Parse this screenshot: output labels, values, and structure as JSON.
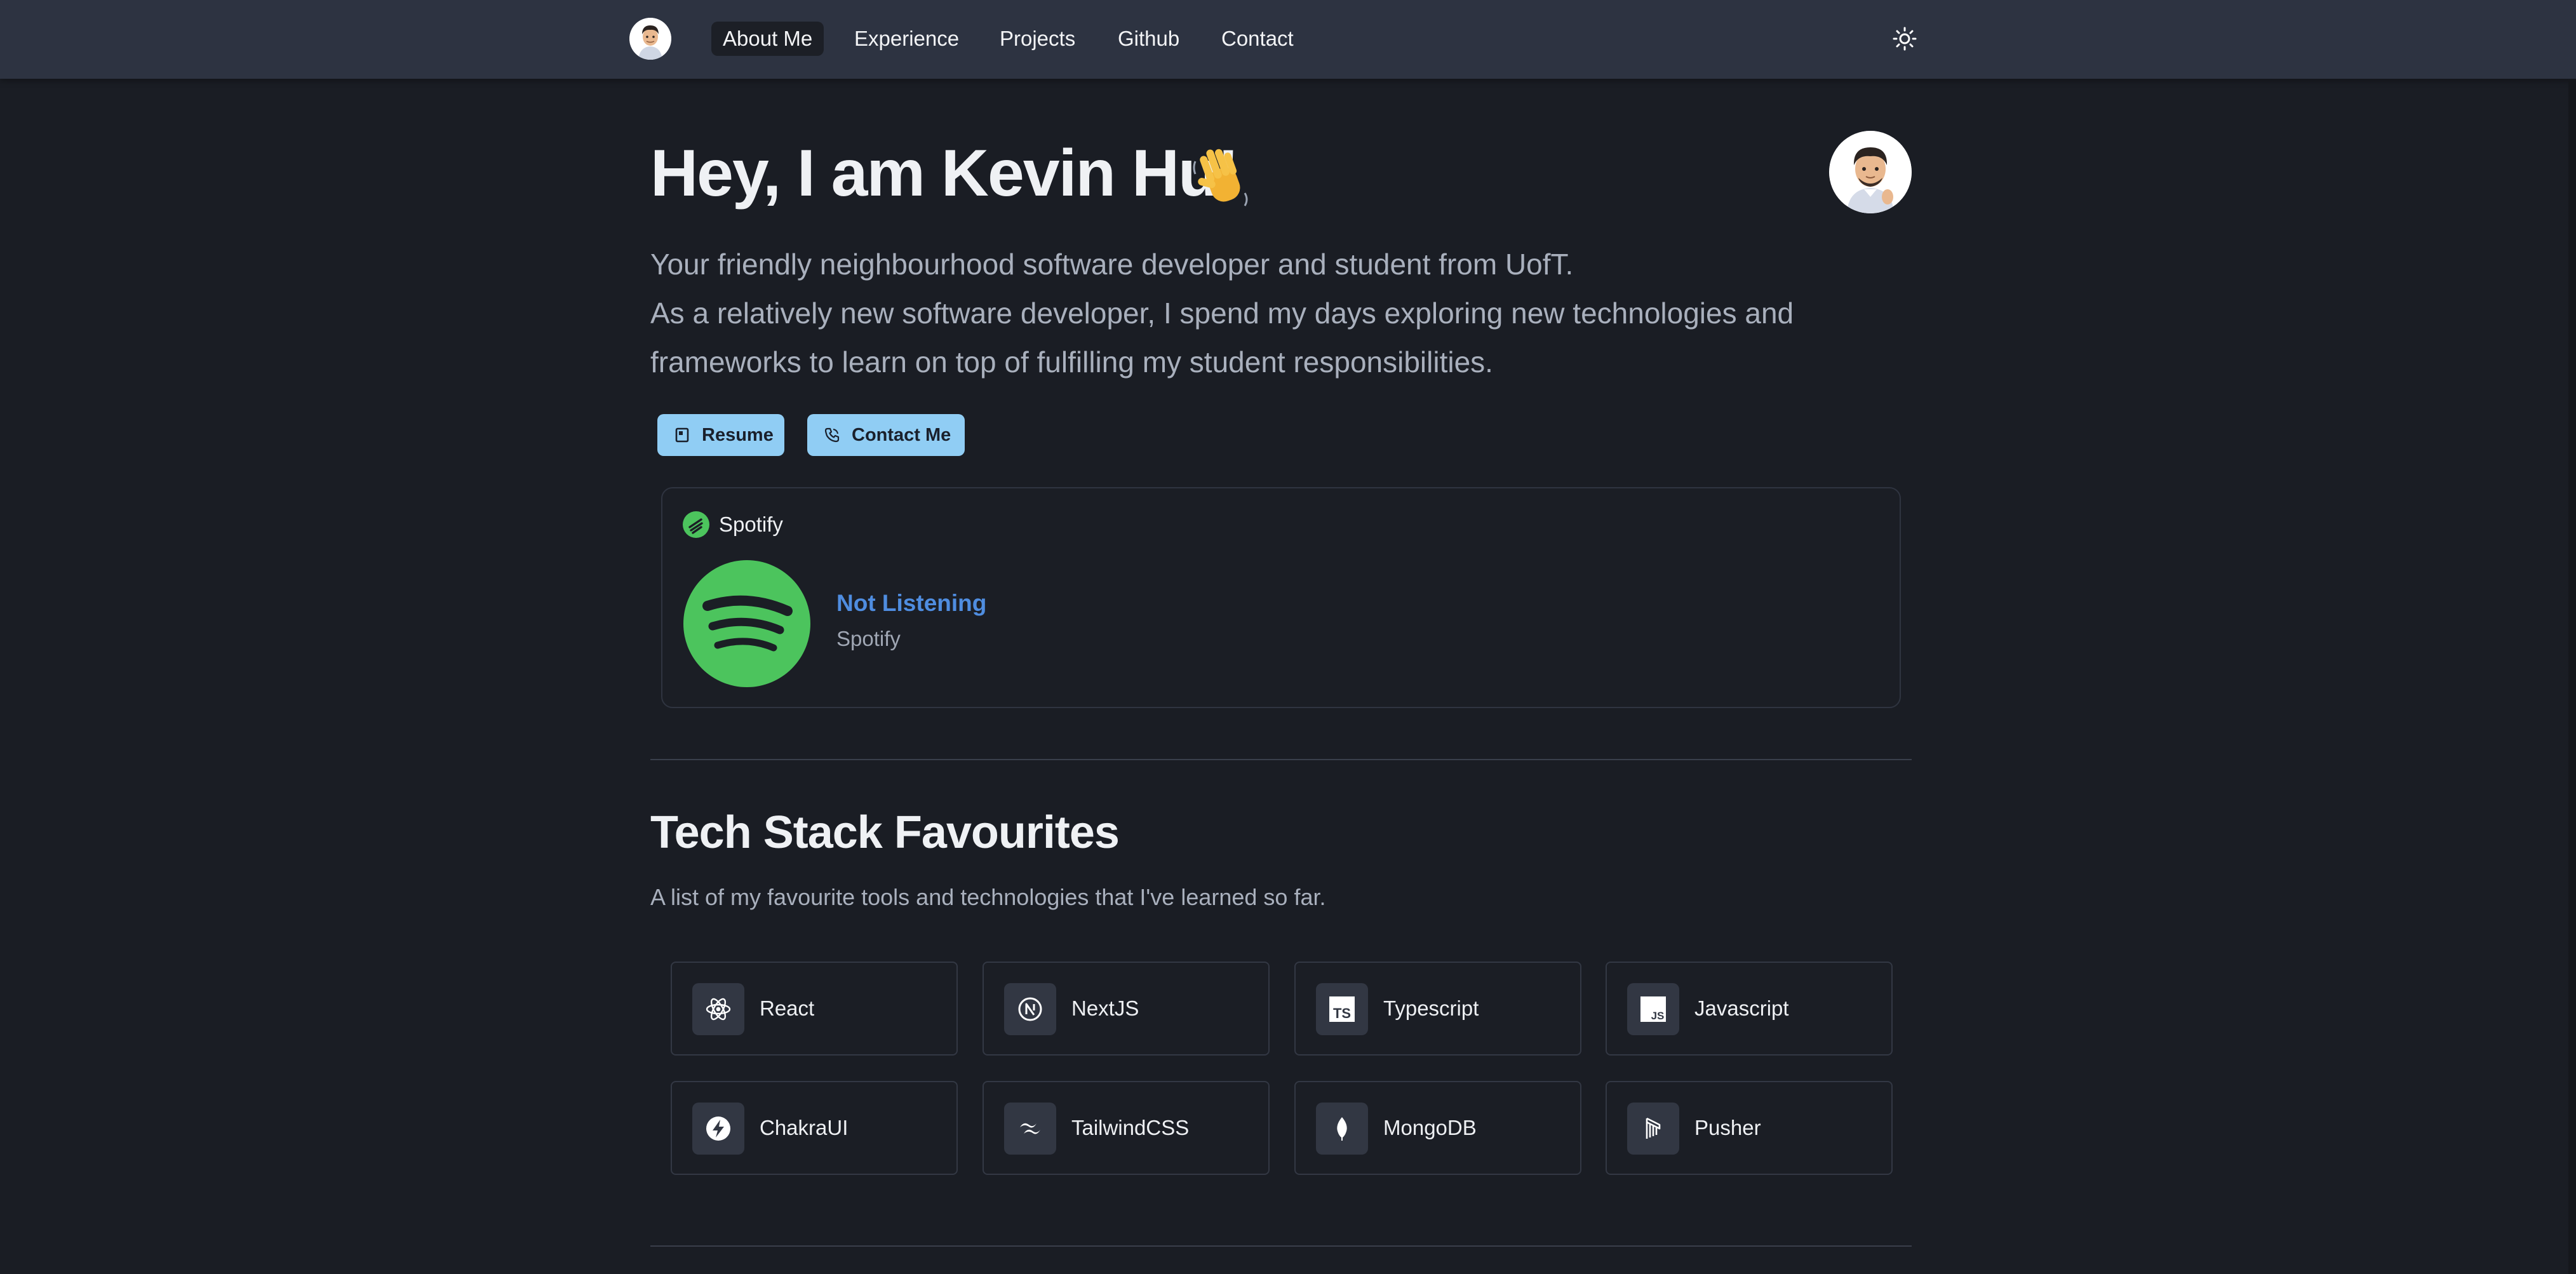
{
  "nav": {
    "items": [
      {
        "label": "About Me",
        "active": true
      },
      {
        "label": "Experience",
        "active": false
      },
      {
        "label": "Projects",
        "active": false
      },
      {
        "label": "Github",
        "active": false
      },
      {
        "label": "Contact",
        "active": false
      }
    ],
    "theme_toggle_icon": "sun-icon"
  },
  "hero": {
    "title": "Hey, I am Kevin Hu!",
    "title_emoji_icon": "waving-hand-icon",
    "lines": [
      "Your friendly neighbourhood software developer and student from UofT.",
      "As a relatively new software developer, I spend my days exploring new technologies and",
      "frameworks to learn on top of fulfilling my student responsibilities."
    ],
    "buttons": {
      "resume": "Resume",
      "contact": "Contact Me"
    }
  },
  "spotify": {
    "header": "Spotify",
    "status": "Not Listening",
    "source": "Spotify"
  },
  "tech": {
    "title": "Tech Stack Favourites",
    "subtitle": "A list of my favourite tools and technologies that I've learned so far.",
    "items": [
      {
        "label": "React",
        "icon": "react-icon"
      },
      {
        "label": "NextJS",
        "icon": "nextjs-icon"
      },
      {
        "label": "Typescript",
        "icon": "typescript-icon"
      },
      {
        "label": "Javascript",
        "icon": "javascript-icon"
      },
      {
        "label": "ChakraUI",
        "icon": "chakraui-icon"
      },
      {
        "label": "TailwindCSS",
        "icon": "tailwindcss-icon"
      },
      {
        "label": "MongoDB",
        "icon": "mongodb-icon"
      },
      {
        "label": "Pusher",
        "icon": "pusher-icon"
      }
    ]
  },
  "colors": {
    "background": "#1a1d24",
    "navbar": "#2d3341",
    "accent_button": "#90cdf4",
    "spotify_green": "#4cc45d",
    "link_blue": "#4f8de0"
  }
}
